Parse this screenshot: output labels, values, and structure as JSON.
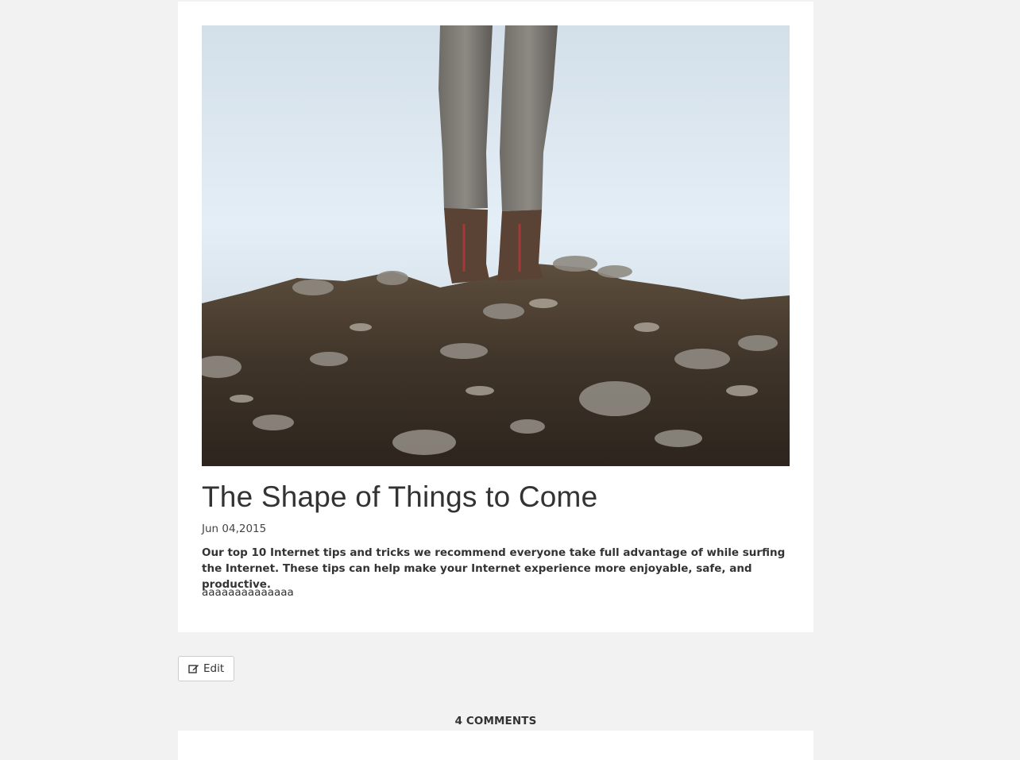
{
  "article": {
    "image_alt": "feet-on-rocky-hilltop-photo",
    "title": "The Shape of Things to Come",
    "date": "Jun 04,2015",
    "summary": "Our top 10 Internet tips and tricks we recommend everyone take full advantage of while surfing the Internet. These tips can help make your Internet experience more enjoyable, safe, and productive.",
    "body": "aaaaaaaaaaaaaa"
  },
  "actions": {
    "edit_label": "Edit",
    "edit_icon": "edit-icon"
  },
  "comments": {
    "heading": "4 COMMENTS"
  },
  "colors": {
    "page_background": "#f2f2f2",
    "card_background": "#ffffff",
    "text": "#333333"
  }
}
